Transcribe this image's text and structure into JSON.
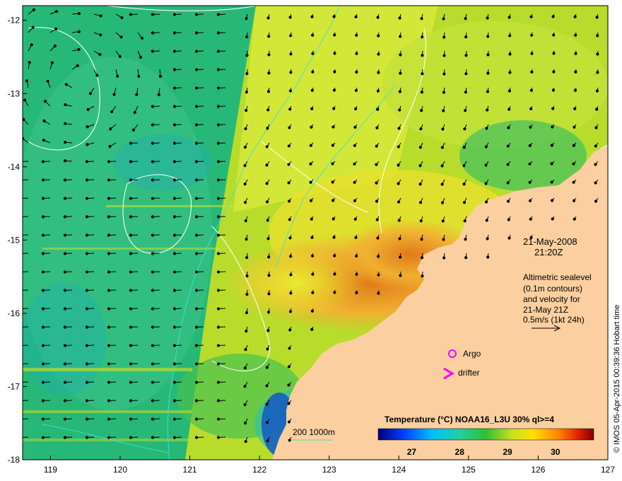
{
  "map": {
    "lon_ticks": [
      "119",
      "120",
      "121",
      "122",
      "123",
      "124",
      "125",
      "126",
      "127"
    ],
    "lat_ticks": [
      "-12",
      "-13",
      "-14",
      "-15",
      "-16",
      "-17",
      "-18"
    ],
    "lon_range": [
      118.6,
      127.0
    ],
    "lat_range": [
      -18.0,
      -11.8
    ]
  },
  "annotation": {
    "date": "21-May-2008",
    "time": "21:20Z",
    "lines": [
      "Altimetric sealevel",
      "(0.1m contours)",
      "and velocity for",
      "21-May 21Z",
      "0.5m/s (1kt 24h)"
    ]
  },
  "markers": {
    "argo_label": "Argo",
    "drifter_label": "drifter",
    "argo_color": "#ff00ff",
    "drifter_color": "#ff00ff"
  },
  "bathymetry_legend": {
    "label": "200  1000m",
    "color": "#40e0d0"
  },
  "colorbar": {
    "title": "Temperature (°C) NOAA16_L3U 30% ql>=4",
    "ticks": [
      "27",
      "28",
      "29",
      "30"
    ],
    "range": [
      26.3,
      30.8
    ]
  },
  "credit": "© IMOS 05-Apr-2015 00:39:36 Hobart time",
  "colors": {
    "land": "#fbcfa0",
    "cool_sst": "#22b86a",
    "warm_sst": "#d9e62a",
    "hot_sst": "#e98a1e"
  }
}
